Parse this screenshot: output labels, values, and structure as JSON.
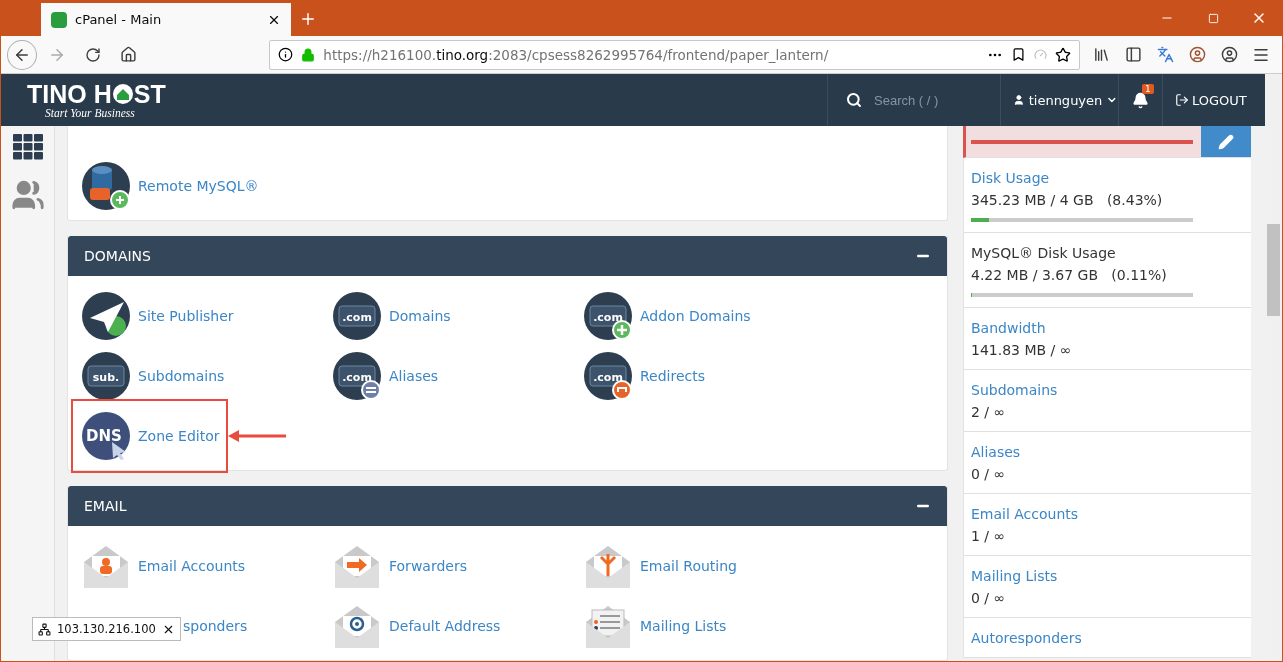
{
  "browser": {
    "tab": {
      "title": "cPanel - Main"
    },
    "url": {
      "scheme": "https://h216100.",
      "domain": "tino.org",
      "path": ":2083/cpsess8262995764/frontend/paper_lantern/"
    }
  },
  "header": {
    "logo": {
      "left": "TINO H",
      "right": "ST",
      "tagline": "Start Your Business"
    },
    "search": {
      "placeholder": "Search ( / )"
    },
    "user": "tiennguyen",
    "notifications": "1",
    "logout": "LOGOUT"
  },
  "sections": [
    {
      "items": [
        {
          "label": "Remote MySQL®",
          "highlighted": false
        }
      ]
    },
    {
      "title": "DOMAINS",
      "items": [
        {
          "label": "Site Publisher",
          "highlighted": false
        },
        {
          "label": "Domains",
          "badge": ".com",
          "highlighted": false
        },
        {
          "label": "Addon Domains",
          "badge": ".com",
          "highlighted": false
        },
        {
          "label": "Subdomains",
          "badge": "sub.",
          "highlighted": false
        },
        {
          "label": "Aliases",
          "badge": ".com",
          "highlighted": false
        },
        {
          "label": "Redirects",
          "badge": ".com",
          "highlighted": false
        },
        {
          "label": "Zone Editor",
          "badge": "DNS",
          "highlighted": true
        }
      ]
    },
    {
      "title": "EMAIL",
      "items": [
        {
          "kind": "tile",
          "label": "Email Accounts",
          "highlighted": false
        },
        {
          "kind": "tile",
          "label": "Forwarders",
          "highlighted": false
        },
        {
          "kind": "tile",
          "label": "Email Routing",
          "highlighted": false
        },
        {
          "kind": "covered",
          "label": "sponders",
          "highlighted": false
        },
        {
          "kind": "tile",
          "label": "Default Address",
          "highlighted": false
        },
        {
          "kind": "tile",
          "label": "Mailing Lists",
          "highlighted": false
        }
      ]
    }
  ],
  "stats": [
    {
      "kind": "warning",
      "level": 1
    },
    {
      "kind": "meter",
      "title": "Disk Usage",
      "link": true,
      "value": "345.23 MB / 4 GB",
      "percent": "(8.43%)",
      "level": 0.08
    },
    {
      "kind": "meter",
      "title": "MySQL® Disk Usage",
      "link": false,
      "value": "4.22 MB / 3.67 GB",
      "percent": "(0.11%)",
      "level": 0.001
    },
    {
      "kind": "plain",
      "title": "Bandwidth",
      "link": true,
      "value": "141.83 MB / ∞"
    },
    {
      "kind": "plain",
      "title": "Subdomains",
      "link": true,
      "value": "2 / ∞"
    },
    {
      "kind": "plain",
      "title": "Aliases",
      "link": true,
      "value": "0 / ∞"
    },
    {
      "kind": "plain",
      "title": "Email Accounts",
      "link": true,
      "value": "1 / ∞"
    },
    {
      "kind": "plain",
      "title": "Mailing Lists",
      "link": true,
      "value": "0 / ∞"
    },
    {
      "kind": "plain",
      "title": "Autoresponders",
      "link": true
    }
  ],
  "tooltip": {
    "ip": "103.130.216.100"
  }
}
